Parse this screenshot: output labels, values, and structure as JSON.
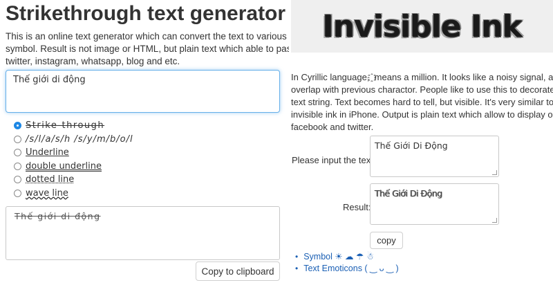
{
  "left": {
    "title": "Strikethrough text generator",
    "intro": [
      "This is an online text generator which can convert the text to various c",
      "symbol. Result is not image or HTML, but plain text which able to past",
      "twitter, instagram, whatsapp, blog and etc."
    ],
    "input_value": "Thế giới di động",
    "options": [
      {
        "label": "Strike-through",
        "selected": true
      },
      {
        "label": "/s/l/a/s/h /s/y/m/b/o/l",
        "selected": false
      },
      {
        "label": "Underline",
        "selected": false
      },
      {
        "label": "double underline",
        "selected": false
      },
      {
        "label": "dotted line",
        "selected": false
      },
      {
        "label": "wave line",
        "selected": false
      }
    ],
    "output_value": "Thế giới di động",
    "copy_label": "Copy to clipboard"
  },
  "right": {
    "banner_title": "Invisible Ink",
    "description": [
      "In Cyrillic language, ҈ means a million. It looks like a noisy signal, and",
      "overlap with previous charactor. People like to use this to decorate the",
      "text string. Text becomes hard to tell, but visible. It's very similar to",
      "invisible ink in iPhone. Output is plain text which allow to display on",
      "facebook and twitter."
    ],
    "input_label": "Please input the text:",
    "input_value": "Thế Giới Di Động",
    "result_label": "Result:",
    "result_value": "Thế Giới Di Động",
    "copy_label": "copy",
    "links": [
      "Symbol ☀ ☁ ☂ ☃",
      "Text Emoticons ( ‿ ᴗ ‿ )"
    ]
  },
  "colors": {
    "accent": "#1e88e5",
    "link": "#1a5fb4",
    "banner_bg": "#efefef",
    "focus_border": "#66afe9"
  }
}
